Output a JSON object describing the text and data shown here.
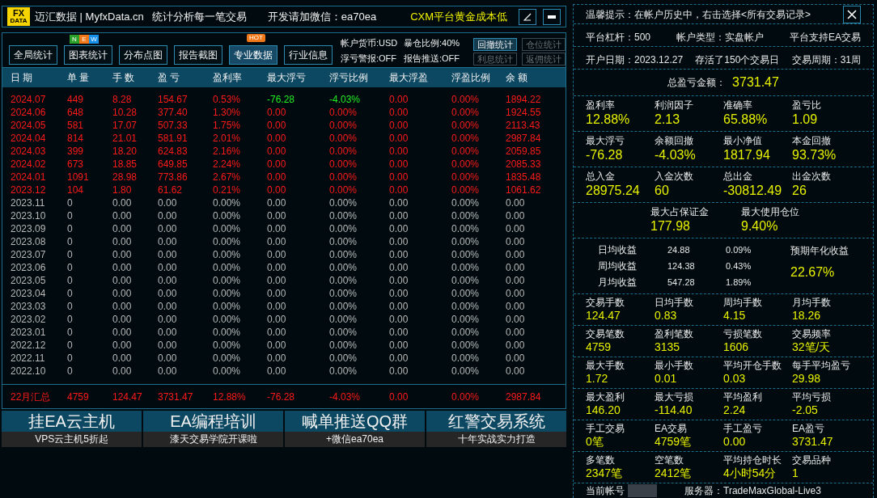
{
  "title_bar": {
    "logo_top": "FX",
    "logo_bottom": "DATA",
    "brand": "迈汇数据 | MyfxData.cn",
    "slogan": "统计分析每一笔交易",
    "contact": "开发请加微信：ea70ea",
    "promo": "CXM平台黄金成本低"
  },
  "toolbar": {
    "tabs": [
      {
        "label": "全局统计",
        "selected": false
      },
      {
        "label": "图表统计",
        "selected": false,
        "badge": {
          "kind": "new",
          "letters": [
            "N",
            "E",
            "W"
          ]
        }
      },
      {
        "label": "分布点图",
        "selected": false
      },
      {
        "label": "报告截图",
        "selected": false
      },
      {
        "label": "专业数据",
        "selected": true,
        "badge": {
          "kind": "hot",
          "text": "HOT"
        }
      },
      {
        "label": "行业信息",
        "selected": false
      }
    ],
    "info": [
      [
        "帐户货币:USD",
        "暴仓比例:40%"
      ],
      [
        "浮亏警报:OFF",
        "报告推送:OFF"
      ]
    ],
    "small_buttons": [
      [
        {
          "label": "回撤统计",
          "disabled": false
        },
        {
          "label": "仓位统计",
          "disabled": true
        }
      ],
      [
        {
          "label": "利息统计",
          "disabled": true
        },
        {
          "label": "返佣统计",
          "disabled": true
        }
      ]
    ]
  },
  "table": {
    "columns": [
      "日 期",
      "单 量",
      "手 数",
      "盈 亏",
      "盈利率",
      "最大浮亏",
      "浮亏比例",
      "最大浮盈",
      "浮盈比例",
      "余 额"
    ],
    "rows": [
      {
        "kind": "profit",
        "float_alert": true,
        "cells": [
          "2024.07",
          "449",
          "8.28",
          "154.67",
          "0.53%",
          "-76.28",
          "-4.03%",
          "0.00",
          "0.00%",
          "1894.22"
        ]
      },
      {
        "kind": "profit",
        "float_alert": false,
        "cells": [
          "2024.06",
          "648",
          "10.28",
          "377.40",
          "1.30%",
          "0.00",
          "0.00%",
          "0.00",
          "0.00%",
          "1924.55"
        ]
      },
      {
        "kind": "profit",
        "float_alert": false,
        "cells": [
          "2024.05",
          "581",
          "17.07",
          "507.33",
          "1.75%",
          "0.00",
          "0.00%",
          "0.00",
          "0.00%",
          "2113.43"
        ]
      },
      {
        "kind": "profit",
        "float_alert": false,
        "cells": [
          "2024.04",
          "814",
          "21.01",
          "581.91",
          "2.01%",
          "0.00",
          "0.00%",
          "0.00",
          "0.00%",
          "2987.84"
        ]
      },
      {
        "kind": "profit",
        "float_alert": false,
        "cells": [
          "2024.03",
          "399",
          "18.20",
          "624.83",
          "2.16%",
          "0.00",
          "0.00%",
          "0.00",
          "0.00%",
          "2059.85"
        ]
      },
      {
        "kind": "profit",
        "float_alert": false,
        "cells": [
          "2024.02",
          "673",
          "18.85",
          "649.85",
          "2.24%",
          "0.00",
          "0.00%",
          "0.00",
          "0.00%",
          "2085.33"
        ]
      },
      {
        "kind": "profit",
        "float_alert": false,
        "cells": [
          "2024.01",
          "1091",
          "28.98",
          "773.86",
          "2.67%",
          "0.00",
          "0.00%",
          "0.00",
          "0.00%",
          "1835.48"
        ]
      },
      {
        "kind": "profit",
        "float_alert": false,
        "cells": [
          "2023.12",
          "104",
          "1.80",
          "61.62",
          "0.21%",
          "0.00",
          "0.00%",
          "0.00",
          "0.00%",
          "1061.62"
        ]
      },
      {
        "kind": "flat",
        "float_alert": false,
        "cells": [
          "2023.11",
          "0",
          "0.00",
          "0.00",
          "0.00%",
          "0.00",
          "0.00%",
          "0.00",
          "0.00%",
          "0.00"
        ]
      },
      {
        "kind": "flat",
        "float_alert": false,
        "cells": [
          "2023.10",
          "0",
          "0.00",
          "0.00",
          "0.00%",
          "0.00",
          "0.00%",
          "0.00",
          "0.00%",
          "0.00"
        ]
      },
      {
        "kind": "flat",
        "float_alert": false,
        "cells": [
          "2023.09",
          "0",
          "0.00",
          "0.00",
          "0.00%",
          "0.00",
          "0.00%",
          "0.00",
          "0.00%",
          "0.00"
        ]
      },
      {
        "kind": "flat",
        "float_alert": false,
        "cells": [
          "2023.08",
          "0",
          "0.00",
          "0.00",
          "0.00%",
          "0.00",
          "0.00%",
          "0.00",
          "0.00%",
          "0.00"
        ]
      },
      {
        "kind": "flat",
        "float_alert": false,
        "cells": [
          "2023.07",
          "0",
          "0.00",
          "0.00",
          "0.00%",
          "0.00",
          "0.00%",
          "0.00",
          "0.00%",
          "0.00"
        ]
      },
      {
        "kind": "flat",
        "float_alert": false,
        "cells": [
          "2023.06",
          "0",
          "0.00",
          "0.00",
          "0.00%",
          "0.00",
          "0.00%",
          "0.00",
          "0.00%",
          "0.00"
        ]
      },
      {
        "kind": "flat",
        "float_alert": false,
        "cells": [
          "2023.05",
          "0",
          "0.00",
          "0.00",
          "0.00%",
          "0.00",
          "0.00%",
          "0.00",
          "0.00%",
          "0.00"
        ]
      },
      {
        "kind": "flat",
        "float_alert": false,
        "cells": [
          "2023.04",
          "0",
          "0.00",
          "0.00",
          "0.00%",
          "0.00",
          "0.00%",
          "0.00",
          "0.00%",
          "0.00"
        ]
      },
      {
        "kind": "flat",
        "float_alert": false,
        "cells": [
          "2023.03",
          "0",
          "0.00",
          "0.00",
          "0.00%",
          "0.00",
          "0.00%",
          "0.00",
          "0.00%",
          "0.00"
        ]
      },
      {
        "kind": "flat",
        "float_alert": false,
        "cells": [
          "2023.02",
          "0",
          "0.00",
          "0.00",
          "0.00%",
          "0.00",
          "0.00%",
          "0.00",
          "0.00%",
          "0.00"
        ]
      },
      {
        "kind": "flat",
        "float_alert": false,
        "cells": [
          "2023.01",
          "0",
          "0.00",
          "0.00",
          "0.00%",
          "0.00",
          "0.00%",
          "0.00",
          "0.00%",
          "0.00"
        ]
      },
      {
        "kind": "flat",
        "float_alert": false,
        "cells": [
          "2022.12",
          "0",
          "0.00",
          "0.00",
          "0.00%",
          "0.00",
          "0.00%",
          "0.00",
          "0.00%",
          "0.00"
        ]
      },
      {
        "kind": "flat",
        "float_alert": false,
        "cells": [
          "2022.11",
          "0",
          "0.00",
          "0.00",
          "0.00%",
          "0.00",
          "0.00%",
          "0.00",
          "0.00%",
          "0.00"
        ]
      },
      {
        "kind": "flat",
        "float_alert": false,
        "cells": [
          "2022.10",
          "0",
          "0.00",
          "0.00",
          "0.00%",
          "0.00",
          "0.00%",
          "0.00",
          "0.00%",
          "0.00"
        ]
      }
    ],
    "summary": [
      "22月汇总",
      "4759",
      "124.47",
      "3731.47",
      "12.88%",
      "-76.28",
      "-4.03%",
      "0.00",
      "0.00%",
      "2987.84"
    ]
  },
  "ads": [
    {
      "title": "挂EA云主机",
      "subtitle": "VPS云主机5折起"
    },
    {
      "title": "EA编程培训",
      "subtitle": "漆天交易学院开课啦"
    },
    {
      "title": "喊单推送QQ群",
      "subtitle": "+微信ea70ea"
    },
    {
      "title": "红警交易系统",
      "subtitle": "十年实战实力打造"
    }
  ],
  "panel": {
    "sections": [
      {
        "kind": "notice",
        "text": "温馨提示：在帐户历史中，右击选择<所有交易记录>"
      },
      {
        "kind": "info",
        "items": [
          "平台杠杆：500",
          "帐户类型：实盘帐户",
          "平台支持EA交易"
        ]
      },
      {
        "kind": "info",
        "items": [
          "开户日期：2023.12.27",
          "存活了150个交易日",
          "交易周期：31周"
        ]
      },
      {
        "kind": "total",
        "label": "总盈亏金额：",
        "value": "3731.47"
      },
      {
        "kind": "stats_large",
        "items": [
          {
            "label": "盈利率",
            "value": "12.88%"
          },
          {
            "label": "利润因子",
            "value": "2.13"
          },
          {
            "label": "准确率",
            "value": "65.88%"
          },
          {
            "label": "盈亏比",
            "value": "1.09"
          }
        ]
      },
      {
        "kind": "stats_large",
        "items": [
          {
            "label": "最大浮亏",
            "value": "-76.28"
          },
          {
            "label": "余额回撤",
            "value": "-4.03%"
          },
          {
            "label": "最小净值",
            "value": "1817.94"
          },
          {
            "label": "本金回撤",
            "value": "93.73%"
          }
        ]
      },
      {
        "kind": "stats_large",
        "items": [
          {
            "label": "总入金",
            "value": "28975.24"
          },
          {
            "label": "入金次数",
            "value": "60"
          },
          {
            "label": "总出金",
            "value": "-30812.49"
          },
          {
            "label": "出金次数",
            "value": "26"
          }
        ]
      },
      {
        "kind": "margin",
        "items": [
          {
            "label": "最大占保证金",
            "value": "177.98"
          },
          {
            "label": "最大使用仓位",
            "value": "9.40%"
          }
        ]
      },
      {
        "kind": "returns",
        "rows": [
          {
            "label": "日均收益",
            "amount": "24.88",
            "pct": "0.09%"
          },
          {
            "label": "周均收益",
            "amount": "124.38",
            "pct": "0.43%"
          },
          {
            "label": "月均收益",
            "amount": "547.28",
            "pct": "1.89%"
          }
        ],
        "annual_label": "预期年化收益",
        "annual_value": "22.67%"
      },
      {
        "kind": "stats_small",
        "items": [
          {
            "label": "交易手数",
            "value": "124.47"
          },
          {
            "label": "日均手数",
            "value": "0.83"
          },
          {
            "label": "周均手数",
            "value": "4.15"
          },
          {
            "label": "月均手数",
            "value": "18.26"
          }
        ]
      },
      {
        "kind": "stats_small",
        "items": [
          {
            "label": "交易笔数",
            "value": "4759"
          },
          {
            "label": "盈利笔数",
            "value": "3135"
          },
          {
            "label": "亏损笔数",
            "value": "1606"
          },
          {
            "label": "交易频率",
            "value": "32笔/天"
          }
        ]
      },
      {
        "kind": "stats_small",
        "items": [
          {
            "label": "最大手数",
            "value": "1.72"
          },
          {
            "label": "最小手数",
            "value": "0.01"
          },
          {
            "label": "平均开仓手数",
            "value": "0.03"
          },
          {
            "label": "每手平均盈亏",
            "value": "29.98"
          }
        ]
      },
      {
        "kind": "stats_small",
        "items": [
          {
            "label": "最大盈利",
            "value": "146.20"
          },
          {
            "label": "最大亏损",
            "value": "-114.40"
          },
          {
            "label": "平均盈利",
            "value": "2.24"
          },
          {
            "label": "平均亏损",
            "value": "-2.05"
          }
        ]
      },
      {
        "kind": "stats_small",
        "items": [
          {
            "label": "手工交易",
            "value": "0笔"
          },
          {
            "label": "EA交易",
            "value": "4759笔"
          },
          {
            "label": "手工盈亏",
            "value": "0.00"
          },
          {
            "label": "EA盈亏",
            "value": "3731.47"
          }
        ]
      },
      {
        "kind": "stats_small",
        "items": [
          {
            "label": "多笔数",
            "value": "2347笔"
          },
          {
            "label": "空笔数",
            "value": "2412笔"
          },
          {
            "label": "平均持仓时长",
            "value": "4小时54分"
          },
          {
            "label": "交易品种",
            "value": "1"
          }
        ]
      },
      {
        "kind": "account",
        "label": "当前帐号",
        "server": "服务器：TradeMaxGlobal-Live3"
      }
    ]
  }
}
